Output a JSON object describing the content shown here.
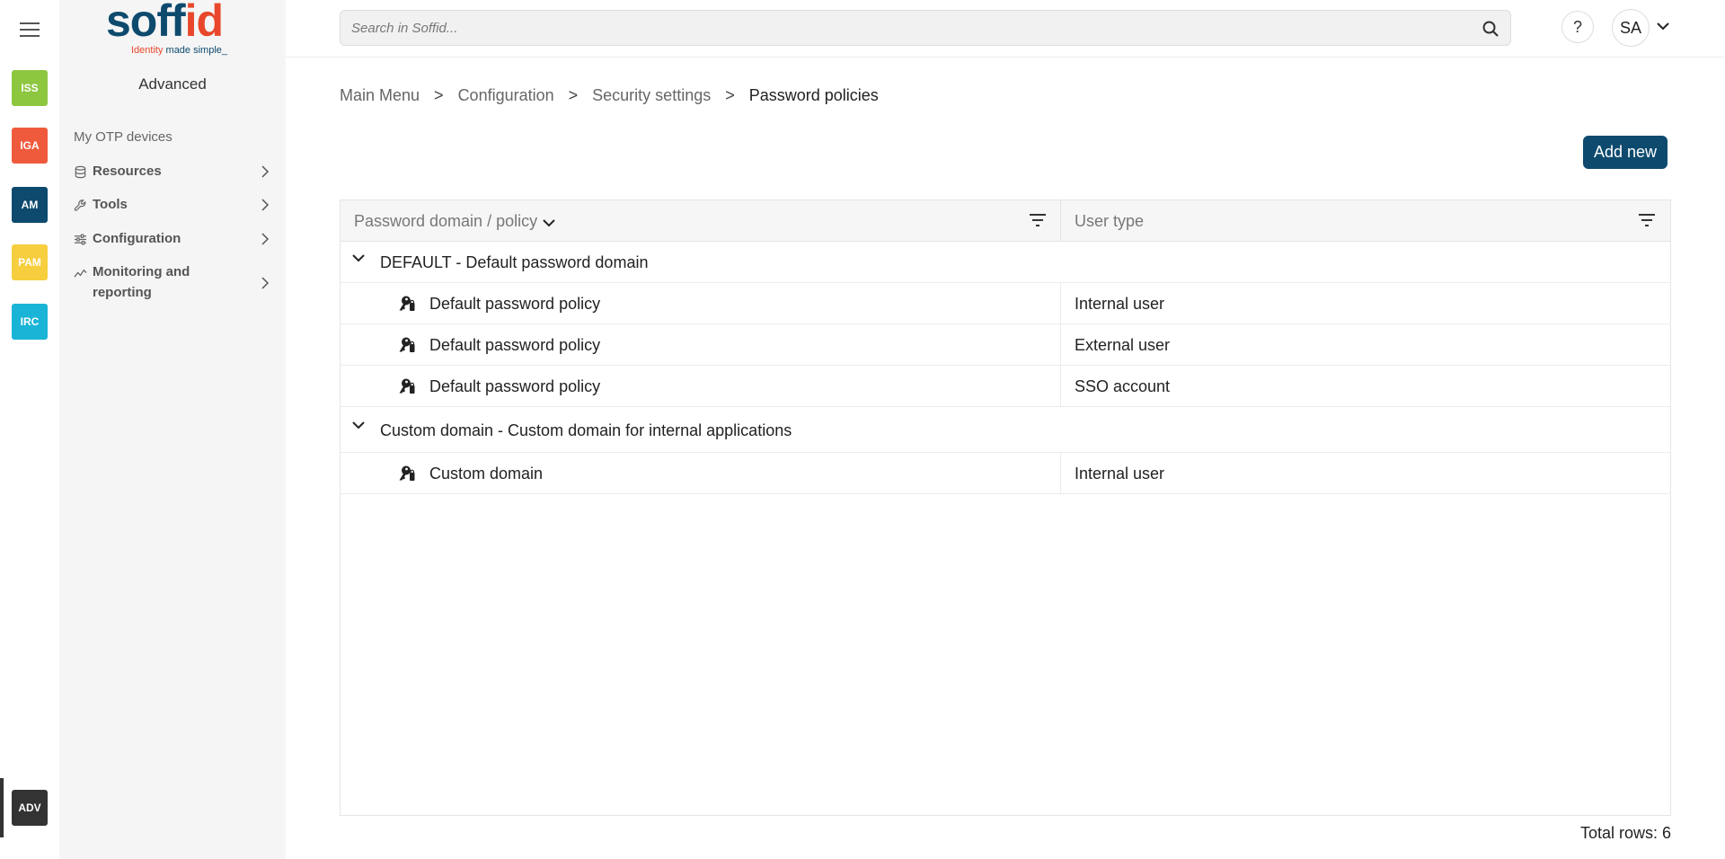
{
  "rail": {
    "apps": [
      {
        "label": "ISS",
        "color": "#8dc63f"
      },
      {
        "label": "IGA",
        "color": "#f05a3c"
      },
      {
        "label": "AM",
        "color": "#0d4a6e"
      },
      {
        "label": "PAM",
        "color": "#f7ce3e"
      },
      {
        "label": "IRC",
        "color": "#1ab4d6"
      }
    ],
    "active_app": {
      "label": "ADV",
      "color": "#333333"
    }
  },
  "logo": {
    "word_blue": "soff",
    "word_red": "id",
    "tag_red": "Identity ",
    "tag_blue": "made simple_"
  },
  "sidebar": {
    "title": "Advanced",
    "items": [
      {
        "label": "My OTP devices"
      },
      {
        "label": "Resources",
        "icon": "database-icon"
      },
      {
        "label": "Tools",
        "icon": "wrench-icon"
      },
      {
        "label": "Configuration",
        "icon": "sliders-icon"
      },
      {
        "label": "Monitoring and reporting",
        "icon": "chart-line-icon"
      }
    ]
  },
  "topbar": {
    "search_placeholder": "Search in Soffid...",
    "help_label": "?",
    "avatar_initials": "SA"
  },
  "breadcrumb": [
    "Main Menu",
    "Configuration",
    "Security settings",
    "Password policies"
  ],
  "breadcrumb_sep": ">",
  "actions": {
    "add_new": "Add new"
  },
  "table": {
    "columns": [
      "Password domain / policy",
      "User type"
    ],
    "groups": [
      {
        "label": "DEFAULT - Default password domain",
        "rows": [
          {
            "policy": "Default password policy",
            "user_type": "Internal user"
          },
          {
            "policy": "Default password policy",
            "user_type": "External user"
          },
          {
            "policy": "Default password policy",
            "user_type": "SSO account"
          }
        ]
      },
      {
        "label": "Custom domain - Custom domain for internal applications",
        "rows": [
          {
            "policy": "Custom domain",
            "user_type": "Internal user"
          }
        ]
      }
    ],
    "total_rows": "Total rows: 6"
  }
}
